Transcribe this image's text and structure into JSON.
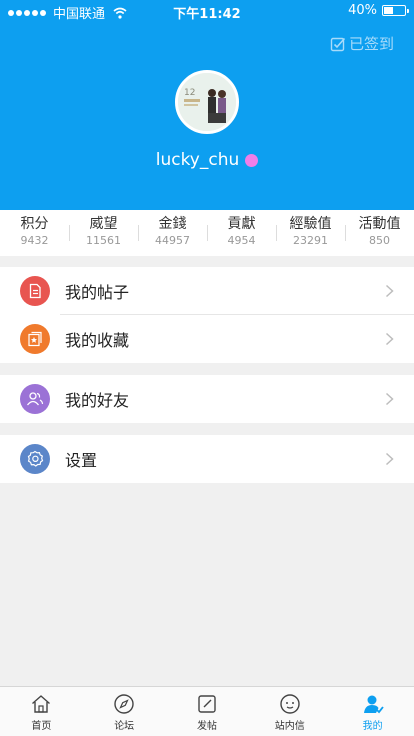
{
  "status_bar": {
    "carrier": "中国联通",
    "time": "下午11:42",
    "battery": "40%",
    "battery_level": 0.4
  },
  "header": {
    "checkin_label": "已签到",
    "username": "lucky_chu",
    "avatar_caption": "12"
  },
  "stats": [
    {
      "label": "积分",
      "value": "9432"
    },
    {
      "label": "威望",
      "value": "11561"
    },
    {
      "label": "金錢",
      "value": "44957"
    },
    {
      "label": "貢獻",
      "value": "4954"
    },
    {
      "label": "經驗值",
      "value": "23291"
    },
    {
      "label": "活動值",
      "value": "850"
    }
  ],
  "menu": {
    "my_posts": {
      "label": "我的帖子",
      "icon": "document-icon",
      "color": "#e85550"
    },
    "my_favorites": {
      "label": "我的收藏",
      "icon": "star-collection-icon",
      "color": "#f07a2c"
    },
    "my_friends": {
      "label": "我的好友",
      "icon": "friends-icon",
      "color": "#9b72d6"
    },
    "settings": {
      "label": "设置",
      "icon": "gear-icon",
      "color": "#5b86c9"
    }
  },
  "tabbar": [
    {
      "label": "首页",
      "icon": "home-icon",
      "active": false
    },
    {
      "label": "论坛",
      "icon": "compass-icon",
      "active": false
    },
    {
      "label": "发帖",
      "icon": "compose-icon",
      "active": false
    },
    {
      "label": "站内信",
      "icon": "message-icon",
      "active": false
    },
    {
      "label": "我的",
      "icon": "profile-icon",
      "active": true
    }
  ],
  "colors": {
    "accent": "#0d9ff0",
    "background": "#f0f0f0"
  }
}
